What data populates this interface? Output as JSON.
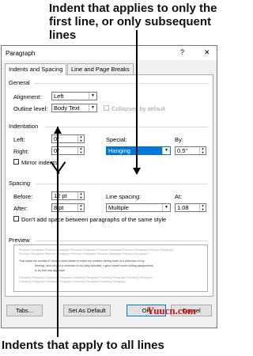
{
  "callouts": {
    "top": "Indent that applies to only the first line, or only subsequent lines",
    "bottom": "Indents that apply to all lines"
  },
  "dialog": {
    "title": "Paragraph",
    "help_glyph": "?",
    "close_glyph": "✕",
    "tabs": [
      {
        "label": "Indents and Spacing",
        "active": true
      },
      {
        "label": "Line and Page Breaks",
        "active": false
      }
    ]
  },
  "general": {
    "heading": "General",
    "alignment_label": "Alignment:",
    "alignment_value": "Left",
    "outline_label": "Outline level:",
    "outline_value": "Body Text",
    "collapsed_label": "Collapsed by default"
  },
  "indentation": {
    "heading": "Indentation",
    "left_label": "Left:",
    "left_value": "0\"",
    "right_label": "Right:",
    "right_value": "0\"",
    "special_label": "Special:",
    "special_value": "Hanging",
    "by_label": "By:",
    "by_value": "0.5\"",
    "mirror_label": "Mirror indents"
  },
  "spacing": {
    "heading": "Spacing",
    "before_label": "Before:",
    "before_value": "12 pt",
    "after_label": "After:",
    "after_value": "8 pt",
    "line_spacing_label": "Line spacing:",
    "line_spacing_value": "Multiple",
    "at_label": "At:",
    "at_value": "1.08",
    "dont_add_label": "Don't add space between paragraphs of the same style"
  },
  "preview": {
    "heading": "Preview",
    "prev_lines": [
      "Previous Paragraph Previous Paragraph Previous Paragraph Previous Paragraph Previous Paragraph Previous Paragraph",
      "Previous Paragraph Previous Paragraph Previous Paragraph Previous Paragraph Previous Paragraph"
    ],
    "sample_lines": [
      "That made me wonder if I should work harder to make my creative writing more of a reflection of my",
      "feelings, and not just a chronicle of my daily activities. I gave myself some writing assignments",
      "to try this new approach."
    ],
    "next_lines": [
      "Following Paragraph Following Paragraph Following Paragraph Following Paragraph Following Paragraph",
      "Following Paragraph Following Paragraph Following Paragraph Following Paragraph"
    ]
  },
  "buttons": {
    "tabs": "Tabs...",
    "set_default": "Set As Default",
    "ok": "OK",
    "cancel": "Cancel"
  },
  "watermark": "Yuucn.com"
}
